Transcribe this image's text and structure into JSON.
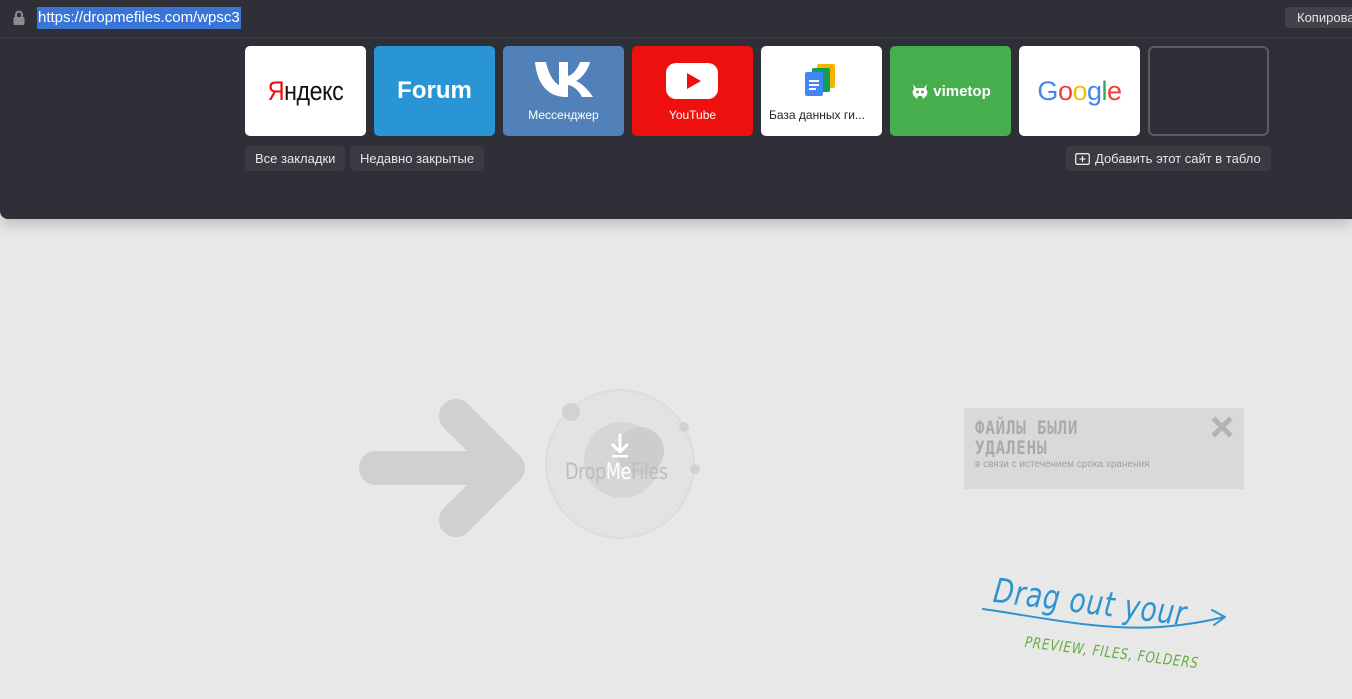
{
  "browser": {
    "url": "https://dropmefiles.com/wpsc3",
    "copy_button": "Копирова",
    "tiles": [
      {
        "name": "Яндекс",
        "first_letter": "Я",
        "rest": "ндекс"
      },
      {
        "name": "Forum"
      },
      {
        "name": "VK",
        "caption": "Мессенджер"
      },
      {
        "name": "YouTube",
        "caption": "YouTube"
      },
      {
        "name": "Google Docs",
        "caption": "База данных ги..."
      },
      {
        "name": "vimetop",
        "caption": "vimetop"
      },
      {
        "name": "Google",
        "letters": [
          "G",
          "o",
          "o",
          "g",
          "l",
          "e"
        ]
      },
      {
        "name": "empty"
      }
    ],
    "all_bookmarks": "Все закладки",
    "recently_closed": "Недавно закрытые",
    "add_site": "Добавить этот сайт в табло"
  },
  "page": {
    "logo": {
      "drop": "Drop",
      "me": "Me",
      "files": "Files"
    },
    "notice": {
      "title": "ФАЙЛЫ БЫЛИ УДАЛЕНЫ",
      "subtitle": "в связи с истечением срока хранения"
    },
    "hint": {
      "line1": "Drag out your",
      "line2": "PREVIEW, FILES, FOLDERS"
    }
  },
  "colors": {
    "overlay_bg": "#2e2f37",
    "url_selection": "#3875d7",
    "page_bg": "#e8e8e8",
    "forum": "#2a95d5",
    "vk": "#5181b8",
    "youtube": "#ee0f0f",
    "vimetop": "#47ae4d",
    "hint_blue": "#2f93cf",
    "hint_green": "#6aac3f"
  }
}
